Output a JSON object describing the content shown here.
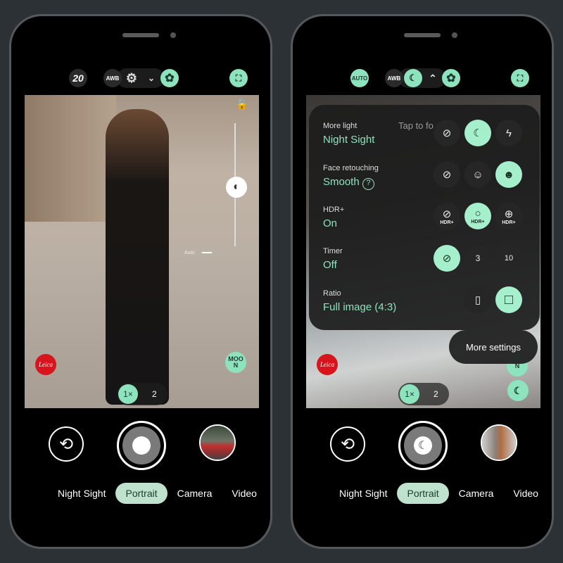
{
  "left": {
    "top_bar": {
      "timer": "20",
      "awb": "AWB",
      "settings_icon": "gear-icon",
      "expand_icon": "chevron-down-icon",
      "active": "gear-icon",
      "face_icon": "face-frame-icon"
    },
    "exposure_labels": [
      "Auto"
    ],
    "moon_button": "MOON",
    "leica": "Leica",
    "zoom": {
      "a": "1×",
      "b": "2"
    },
    "modes": [
      "Night Sight",
      "Portrait",
      "Camera",
      "Video"
    ],
    "active_mode": "Portrait"
  },
  "right": {
    "top_bar": {
      "auto": "AUTO",
      "awb": "AWB",
      "expand_icon": "chevron-up-icon"
    },
    "tap_hint": "Tap to fo",
    "settings": [
      {
        "title": "More light",
        "value": "Night Sight"
      },
      {
        "title": "Face retouching",
        "value": "Smooth"
      },
      {
        "title": "HDR+",
        "value": "On"
      },
      {
        "title": "Timer",
        "value": "Off"
      },
      {
        "title": "Ratio",
        "value": "Full image (4:3)"
      }
    ],
    "hdr_label": "HDR+",
    "timer_opts": [
      "3",
      "10"
    ],
    "more_settings": "More settings",
    "moon_partial": "N",
    "leica": "Leica",
    "zoom": {
      "a": "1×",
      "b": "2"
    },
    "modes": [
      "Night Sight",
      "Portrait",
      "Camera",
      "Video"
    ],
    "active_mode": "Portrait"
  },
  "colors": {
    "accent": "#8de3bd",
    "active_pill": "#bfe2cf"
  }
}
